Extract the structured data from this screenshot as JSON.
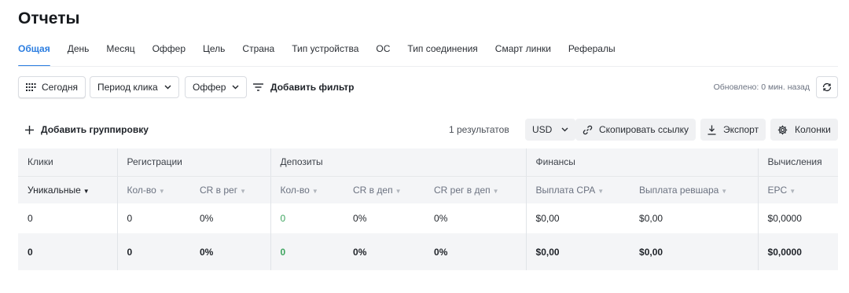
{
  "page": {
    "title": "Отчеты"
  },
  "tabs": [
    {
      "label": "Общая",
      "active": true
    },
    {
      "label": "День"
    },
    {
      "label": "Месяц"
    },
    {
      "label": "Оффер"
    },
    {
      "label": "Цель"
    },
    {
      "label": "Страна"
    },
    {
      "label": "Тип устройства"
    },
    {
      "label": "ОС"
    },
    {
      "label": "Тип соединения"
    },
    {
      "label": "Смарт линки"
    },
    {
      "label": "Рефералы"
    }
  ],
  "toolbar": {
    "date_label": "Сегодня",
    "click_period_label": "Период клика",
    "offer_label": "Оффер",
    "add_filter_label": "Добавить фильтр",
    "updated_text": "Обновлено: 0 мин. назад"
  },
  "actions": {
    "add_grouping_label": "Добавить группировку",
    "results_text": "1 результатов",
    "currency": "USD",
    "copy_link_label": "Скопировать ссылку",
    "export_label": "Экспорт",
    "columns_label": "Колонки"
  },
  "table": {
    "groups": [
      "Клики",
      "Регистрации",
      "Депозиты",
      "Финансы",
      "Вычисления"
    ],
    "columns": [
      "Уникальные",
      "Кол-во",
      "CR в рег",
      "Кол-во",
      "CR в деп",
      "CR рег в деп",
      "Выплата CPA",
      "Выплата ревшара",
      "EPC"
    ],
    "rows": [
      [
        "0",
        "0",
        "0%",
        "0",
        "0%",
        "0%",
        "$0,00",
        "$0,00",
        "$0,0000"
      ]
    ],
    "total": [
      "0",
      "0",
      "0%",
      "0",
      "0%",
      "0%",
      "$0,00",
      "$0,00",
      "$0,0000"
    ]
  },
  "colors": {
    "accent": "#2b7de0",
    "positive": "#3ea55f",
    "header_bg": "#f4f5f7"
  }
}
